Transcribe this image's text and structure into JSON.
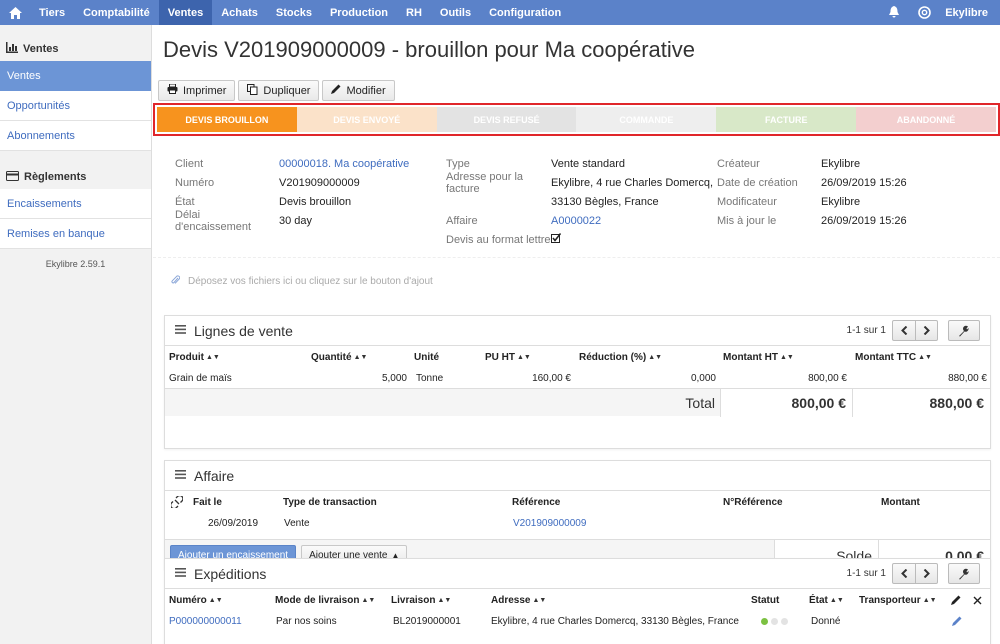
{
  "nav": {
    "items": [
      "Tiers",
      "Comptabilité",
      "Ventes",
      "Achats",
      "Stocks",
      "Production",
      "RH",
      "Outils",
      "Configuration"
    ],
    "active_index": 2,
    "user": "Ekylibre"
  },
  "sidebar": {
    "section1": "Ventes",
    "items1": [
      "Ventes",
      "Opportunités",
      "Abonnements"
    ],
    "section2": "Règlements",
    "items2": [
      "Encaissements",
      "Remises en banque"
    ],
    "version": "Ekylibre 2.59.1"
  },
  "page": {
    "title": "Devis V201909000009 - brouillon pour Ma coopérative",
    "toolbar": {
      "print": "Imprimer",
      "duplicate": "Dupliquer",
      "edit": "Modifier"
    }
  },
  "steps": [
    {
      "label": "DEVIS BROUILLON",
      "bg": "#f7931e",
      "fg": "#ffffff"
    },
    {
      "label": "DEVIS ENVOYÉ",
      "bg": "#fbe2c9",
      "fg": "#ffffff"
    },
    {
      "label": "DEVIS REFUSÉ",
      "bg": "#e3e3e3",
      "fg": "#ffffff"
    },
    {
      "label": "COMMANDE",
      "bg": "#eeeeee",
      "fg": "#ffffff"
    },
    {
      "label": "FACTURE",
      "bg": "#d8e8c8",
      "fg": "#ffffff"
    },
    {
      "label": "ABANDONNÉ",
      "bg": "#f3cfcf",
      "fg": "#ffffff"
    }
  ],
  "fields": {
    "client_label": "Client",
    "client_value": "00000018. Ma coopérative",
    "numero_label": "Numéro",
    "numero_value": "V201909000009",
    "etat_label": "État",
    "etat_value": "Devis brouillon",
    "delai_label": "Délai d'encaissement",
    "delai_value": "30 day",
    "type_label": "Type",
    "type_value": "Vente standard",
    "adresse_label": "Adresse pour la facture",
    "adresse_line1": "Ekylibre, 4 rue Charles Domercq,",
    "adresse_line2": "33130 Bègles, France",
    "affaire_label": "Affaire",
    "affaire_value": "A0000022",
    "format_label": "Devis au format lettre",
    "createur_label": "Créateur",
    "createur_value": "Ekylibre",
    "date_creation_label": "Date de création",
    "date_creation_value": "26/09/2019 15:26",
    "modificateur_label": "Modificateur",
    "modificateur_value": "Ekylibre",
    "mis_a_jour_label": "Mis à jour le",
    "mis_a_jour_value": "26/09/2019 15:26"
  },
  "dropzone": "Déposez vos fichiers ici ou cliquez sur le bouton d'ajout",
  "lignes": {
    "title": "Lignes de vente",
    "pager": "1-1 sur 1",
    "headers": [
      "Produit",
      "Quantité",
      "Unité",
      "PU HT",
      "Réduction (%)",
      "Montant HT",
      "Montant TTC"
    ],
    "row": [
      "Grain de maïs",
      "5,000",
      "Tonne",
      "160,00 €",
      "0,000",
      "800,00 €",
      "880,00 €"
    ],
    "total_label": "Total",
    "total_ht": "800,00 €",
    "total_ttc": "880,00 €"
  },
  "affaire": {
    "title": "Affaire",
    "headers": [
      "Fait le",
      "Type de transaction",
      "Référence",
      "N°Référence",
      "Montant"
    ],
    "row": [
      "26/09/2019",
      "Vente",
      "V201909000009"
    ],
    "btn_encaissement": "Ajouter un encaissement",
    "btn_vente": "Ajouter une vente",
    "solde_label": "Solde",
    "solde_value": "0,00 €"
  },
  "expeditions": {
    "title": "Expéditions",
    "pager": "1-1 sur 1",
    "headers": [
      "Numéro",
      "Mode de livraison",
      "Livraison",
      "Adresse",
      "Statut",
      "État",
      "Transporteur"
    ],
    "row": [
      "P000000000011",
      "Par nos soins",
      "BL2019000001",
      "Ekylibre, 4 rue Charles Domercq, 33130 Bègles, France",
      "Donné"
    ]
  },
  "colors": {
    "nav": "#5b82c9",
    "accent": "#6c95d6",
    "link": "#3f6cbf",
    "status_green": "#7cc142",
    "highlight_border": "#e0262a"
  }
}
